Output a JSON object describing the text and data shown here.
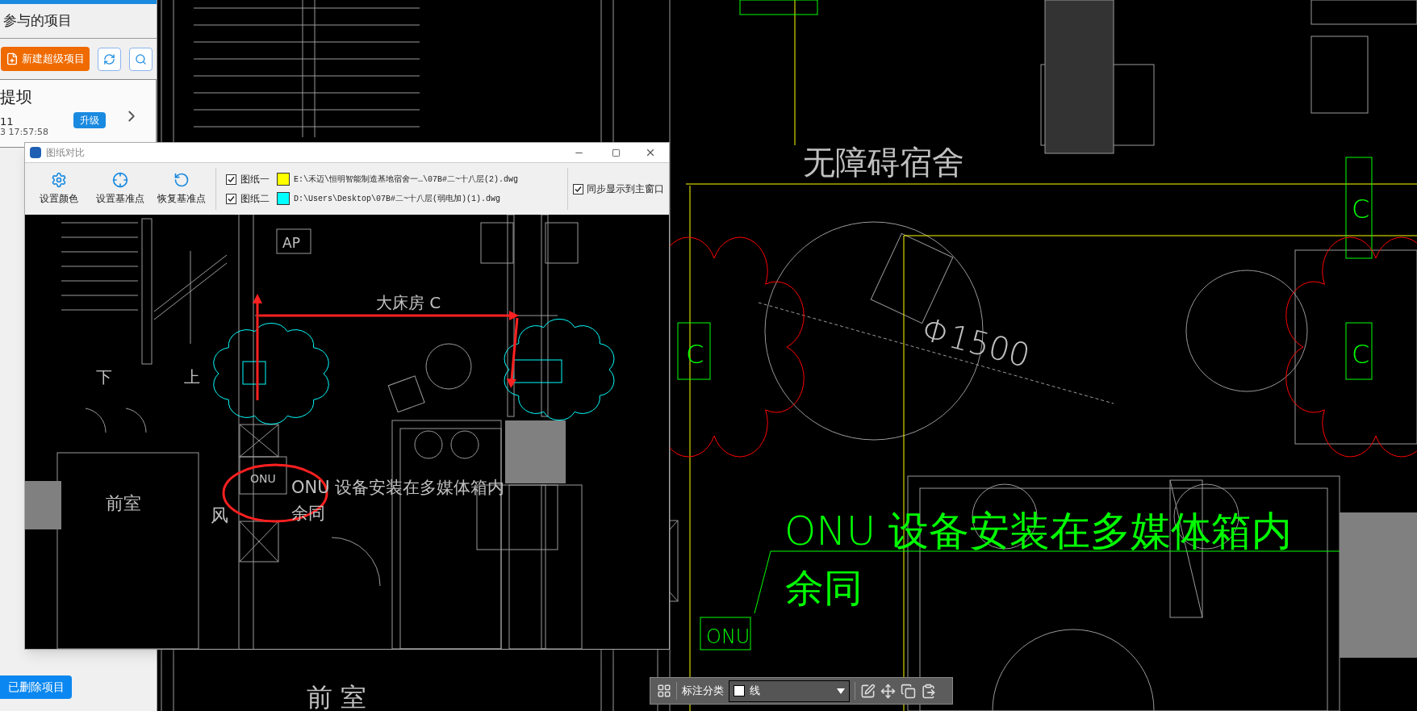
{
  "sidebar": {
    "heading": "参与的项目",
    "new_button": "新建超级项目",
    "project_card": {
      "title": "提坝",
      "count": "11",
      "badge": "升级",
      "time": "3 17:57:58"
    },
    "deleted_button": "已删除项目"
  },
  "cad": {
    "labels": [
      {
        "text": "无障碍宿舍",
        "color": "#c0c0c0"
      },
      {
        "text": "Φ1500",
        "color": "#c0c0c0"
      },
      {
        "text": "C",
        "color": "#00ff00"
      },
      {
        "text": "C",
        "color": "#00ff00"
      },
      {
        "text": "C",
        "color": "#00ff00"
      },
      {
        "text": "ONU 设备安装在多媒体箱内",
        "color": "#00ff00"
      },
      {
        "text": "余同",
        "color": "#00ff00"
      },
      {
        "text": "ONU",
        "color": "#00ff00"
      },
      {
        "text": "前 室",
        "color": "#c0c0c0"
      }
    ]
  },
  "dialog": {
    "title": "图纸对比",
    "tools": [
      {
        "kind": "color",
        "label": "设置颜色"
      },
      {
        "kind": "point",
        "label": "设置基准点"
      },
      {
        "kind": "restore",
        "label": "恢复基准点"
      }
    ],
    "drawings": [
      {
        "label": "图纸一",
        "checked": true,
        "color": "#ffff00",
        "path": "E:\\禾迈\\恒明智能制造基地宿舍一…\\07B#二~十八层(2).dwg"
      },
      {
        "label": "图纸二",
        "checked": true,
        "color": "#00ffff",
        "path": "D:\\Users\\Desktop\\07B#二~十八层(弱电加)(1).dwg"
      }
    ],
    "sync": {
      "label": "同步显示到主窗口",
      "checked": true
    },
    "canvas_labels": [
      {
        "text": "AP",
        "color": "#c0c0c0"
      },
      {
        "text": "下",
        "color": "#c0c0c0"
      },
      {
        "text": "上",
        "color": "#c0c0c0"
      },
      {
        "text": "大床房 C",
        "color": "#c0c0c0"
      },
      {
        "text": "ONU",
        "color": "#c0c0c0"
      },
      {
        "text": "ONU 设备安装在多媒体箱内",
        "color": "#c0c0c0"
      },
      {
        "text": "余同",
        "color": "#c0c0c0"
      },
      {
        "text": "前室",
        "color": "#c0c0c0"
      },
      {
        "text": "风",
        "color": "#c0c0c0"
      }
    ]
  },
  "annotation_toolbar": {
    "label": "标注分类",
    "category": {
      "value": "线",
      "color": "#ffffff"
    }
  }
}
